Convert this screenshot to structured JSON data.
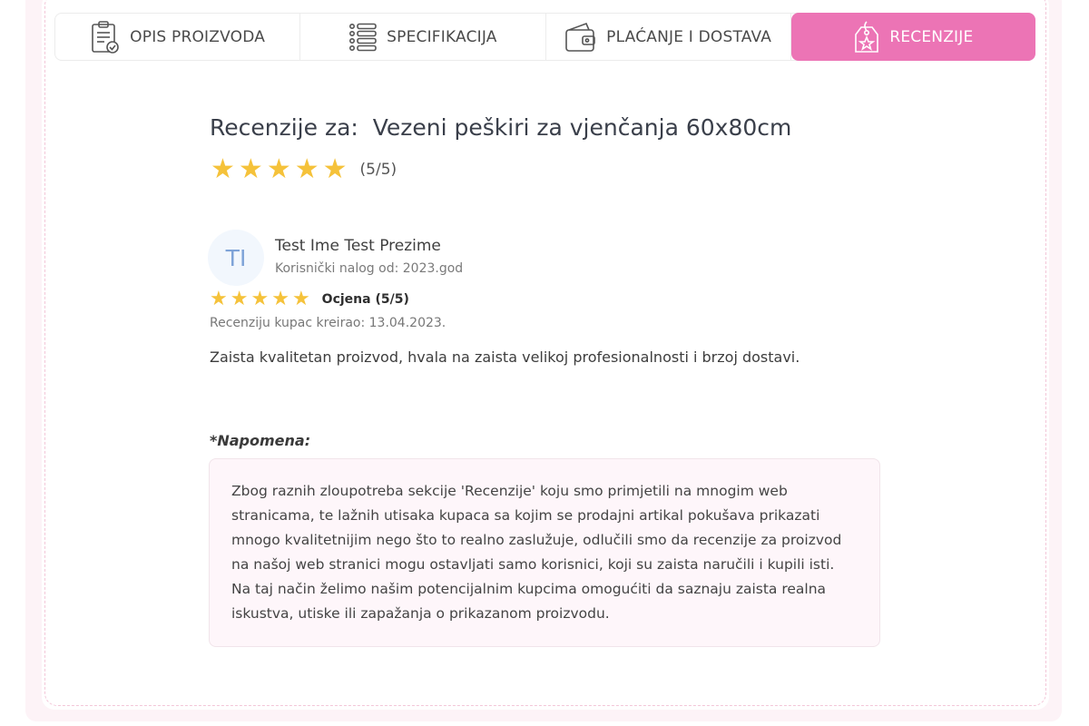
{
  "tabs": [
    {
      "label": "OPIS PROIZVODA",
      "icon": "clipboard-check-icon",
      "active": false
    },
    {
      "label": "SPECIFIKACIJA",
      "icon": "list-icon",
      "active": false
    },
    {
      "label": "PLAĆANJE I DOSTAVA",
      "icon": "wallet-icon",
      "active": false
    },
    {
      "label": "RECENZIJE",
      "icon": "tag-star-icon",
      "active": true
    }
  ],
  "colors": {
    "accent": "#ec74b5",
    "star": "#f5c23a",
    "avatar_text": "#7ea3d8",
    "note_bg": "#fef6fa"
  },
  "reviews_heading": {
    "prefix": "Recenzije za:",
    "product": "Vezeni peškiri za vjenčanja 60x80cm",
    "rating_value": 5,
    "rating_max": 5,
    "rating_text": "(5/5)"
  },
  "review": {
    "avatar_initials": "TI",
    "name": "Test Ime Test Prezime",
    "member_since": "Korisnički nalog od: 2023.god",
    "stars": 5,
    "grade_text": "Ocjena (5/5)",
    "date_text": "Recenziju kupac kreirao: 13.04.2023.",
    "text": "Zaista kvalitetan proizvod, hvala na zaista velikoj profesionalnosti i brzoj dostavi."
  },
  "note": {
    "label": "*Napomena:",
    "lines": [
      "Zbog raznih zloupotreba sekcije 'Recenzije' koju smo primjetili na mnogim web",
      "stranicama, te lažnih utisaka kupaca sa kojim se prodajni artikal pokušava prikazati",
      "mnogo kvalitetnijim nego što to realno zaslužuje, odlučili smo da recenzije za proizvod",
      "na našoj web stranici mogu ostavljati samo korisnici, koji su zaista naručili i kupili isti.",
      "Na taj način želimo našim potencijalnim kupcima omogućiti da saznaju zaista realna",
      "iskustva, utiske ili zapažanja o prikazanom proizvodu."
    ]
  }
}
